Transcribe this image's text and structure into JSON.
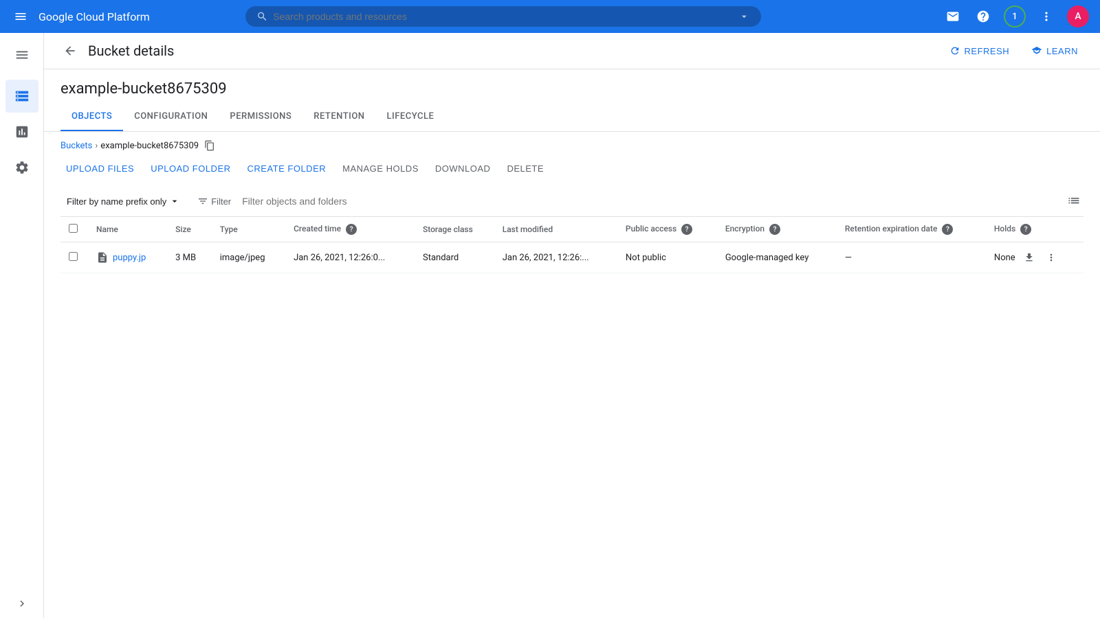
{
  "app": {
    "title": "Google Cloud Platform",
    "search_placeholder": "Search products and resources"
  },
  "header": {
    "back_label": "Bucket details",
    "refresh_label": "REFRESH",
    "learn_label": "LEARN"
  },
  "bucket": {
    "name": "example-bucket8675309"
  },
  "tabs": [
    {
      "id": "objects",
      "label": "OBJECTS",
      "active": true
    },
    {
      "id": "configuration",
      "label": "CONFIGURATION",
      "active": false
    },
    {
      "id": "permissions",
      "label": "PERMISSIONS",
      "active": false
    },
    {
      "id": "retention",
      "label": "RETENTION",
      "active": false
    },
    {
      "id": "lifecycle",
      "label": "LIFECYCLE",
      "active": false
    }
  ],
  "breadcrumb": {
    "buckets_label": "Buckets",
    "current": "example-bucket8675309"
  },
  "actions": {
    "upload_files": "UPLOAD FILES",
    "upload_folder": "UPLOAD FOLDER",
    "create_folder": "CREATE FOLDER",
    "manage_holds": "MANAGE HOLDS",
    "download": "DOWNLOAD",
    "delete": "DELETE"
  },
  "filter": {
    "prefix_label": "Filter by name prefix only",
    "filter_label": "Filter",
    "placeholder": "Filter objects and folders"
  },
  "table": {
    "columns": [
      {
        "id": "name",
        "label": "Name",
        "help": false
      },
      {
        "id": "size",
        "label": "Size",
        "help": false
      },
      {
        "id": "type",
        "label": "Type",
        "help": false
      },
      {
        "id": "created_time",
        "label": "Created time",
        "help": true
      },
      {
        "id": "storage_class",
        "label": "Storage class",
        "help": false
      },
      {
        "id": "last_modified",
        "label": "Last modified",
        "help": false
      },
      {
        "id": "public_access",
        "label": "Public access",
        "help": true
      },
      {
        "id": "encryption",
        "label": "Encryption",
        "help": true
      },
      {
        "id": "retention_expiration",
        "label": "Retention expiration date",
        "help": true
      },
      {
        "id": "holds",
        "label": "Holds",
        "help": true
      }
    ],
    "rows": [
      {
        "name": "puppy.jp",
        "size": "3 MB",
        "type": "image/jpeg",
        "created_time": "Jan 26, 2021, 12:26:0...",
        "storage_class": "Standard",
        "last_modified": "Jan 26, 2021, 12:26:...",
        "public_access": "Not public",
        "encryption": "Google-managed key",
        "retention_expiration": "—",
        "holds": "None"
      }
    ]
  },
  "sidebar": {
    "items": [
      {
        "id": "menu",
        "icon": "menu"
      },
      {
        "id": "storage",
        "icon": "storage",
        "active": true
      },
      {
        "id": "analytics",
        "icon": "analytics"
      },
      {
        "id": "settings",
        "icon": "settings"
      }
    ]
  },
  "notification_count": "1"
}
